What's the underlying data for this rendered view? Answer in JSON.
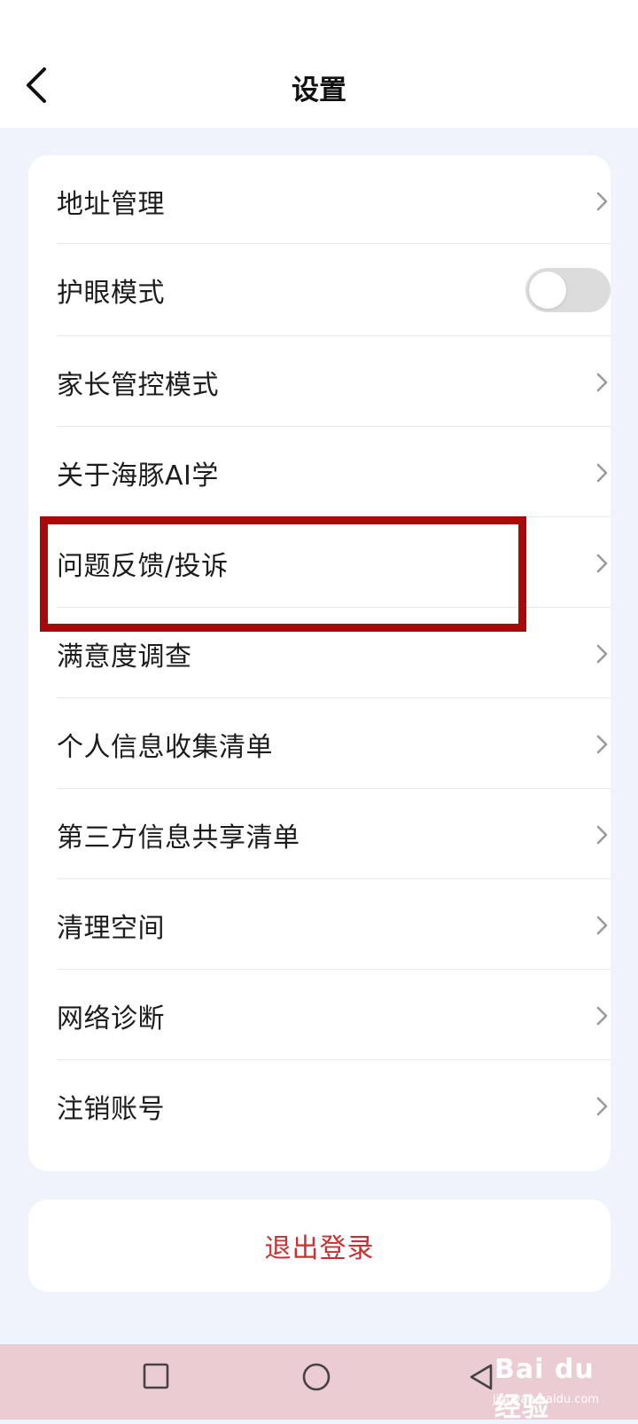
{
  "header": {
    "title": "设置"
  },
  "settings": {
    "items": [
      {
        "label": "地址管理",
        "control": "chevron"
      },
      {
        "label": "护眼模式",
        "control": "toggle",
        "on": false
      },
      {
        "label": "家长管控模式",
        "control": "chevron"
      },
      {
        "label": "关于海豚AI学",
        "control": "chevron"
      },
      {
        "label": "问题反馈/投诉",
        "control": "chevron",
        "highlighted": true
      },
      {
        "label": "满意度调查",
        "control": "chevron"
      },
      {
        "label": "个人信息收集清单",
        "control": "chevron"
      },
      {
        "label": "第三方信息共享清单",
        "control": "chevron"
      },
      {
        "label": "清理空间",
        "control": "chevron"
      },
      {
        "label": "网络诊断",
        "control": "chevron"
      },
      {
        "label": "注销账号",
        "control": "chevron"
      }
    ]
  },
  "logout": {
    "label": "退出登录"
  },
  "watermark": {
    "brand": "Bai du 经验",
    "url": "jingyan.baidu.com"
  },
  "colors": {
    "background": "#eff4fc",
    "card": "#ffffff",
    "logout_text": "#c8312f",
    "highlight_border": "#a80a0a",
    "toggle_off": "#dcdcdc",
    "nav_bar": "#ecccd3"
  },
  "icons": {
    "back": "chevron-left-icon",
    "row_arrow": "chevron-right-icon",
    "nav_recent": "square-icon",
    "nav_home": "circle-icon",
    "nav_back": "triangle-left-icon"
  }
}
